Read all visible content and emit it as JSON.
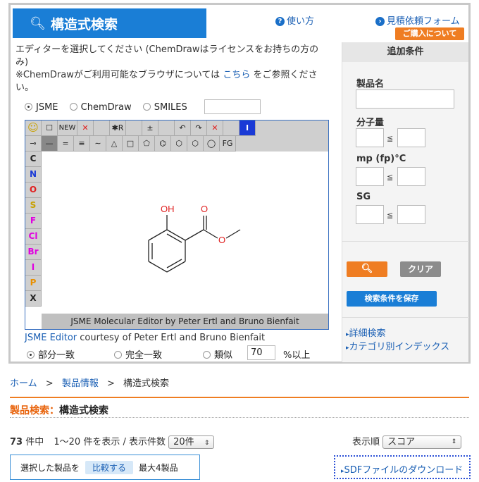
{
  "header": {
    "title": "構造式検索",
    "help_link": "使い方",
    "quote_link": "見積依頼フォーム",
    "purchase_button": "ご購入について"
  },
  "intro": {
    "line1": "エディターを選択してください (ChemDrawはライセンスをお持ちの方のみ)",
    "line2_pre": "※ChemDrawがご利用可能なブラウザについては ",
    "line2_link": "こちら",
    "line2_post": " をご参照ください。"
  },
  "editor_options": [
    "JSME",
    "ChemDraw",
    "SMILES"
  ],
  "editor_selected": "JSME",
  "smiles_value": "",
  "jsme": {
    "toolbar_row1": [
      "☺",
      "☐",
      "NEW",
      "✕",
      "",
      "✱R",
      "",
      "±",
      "",
      "↶",
      "↷",
      "✕",
      "",
      "I"
    ],
    "toolbar_row2": [
      "⊸",
      "—",
      "=",
      "≡",
      "∼",
      "△",
      "□",
      "⬠",
      "⌬",
      "⬡",
      "⬡",
      "◯",
      "FG"
    ],
    "atoms": [
      "C",
      "N",
      "O",
      "S",
      "F",
      "Cl",
      "Br",
      "I",
      "P",
      "X"
    ],
    "atom_colors": [
      "#222222",
      "#1a3ad6",
      "#e02020",
      "#c8a000",
      "#e000e0",
      "#e000e0",
      "#e000e0",
      "#e000e0",
      "#e89000",
      "#222222"
    ],
    "footer": "JSME Molecular Editor by Peter Ertl and Bruno Bienfait",
    "molecule_labels": {
      "oh": "OH",
      "o_carbonyl": "O",
      "o_ester": "O"
    }
  },
  "courtesy": {
    "link": "JSME Editor",
    "text": " courtesy of Peter Ertl and Bruno Bienfait"
  },
  "match": {
    "options": [
      "部分一致",
      "完全一致",
      "類似"
    ],
    "selected": "部分一致",
    "similarity_value": "70",
    "similarity_unit": "%以上"
  },
  "conditions": {
    "heading": "追加条件",
    "product_name_label": "製品名",
    "mw_label": "分子量",
    "mp_label": "mp (fp)°C",
    "sg_label": "SG",
    "le_symbol": "≦",
    "clear_button": "クリア",
    "save_button": "検索条件を保存",
    "detail_link": "詳細検索",
    "category_link": "カテゴリ別インデックス"
  },
  "breadcrumb": {
    "home": "ホーム",
    "sep": ">",
    "products": "製品情報",
    "current": "構造式検索"
  },
  "results": {
    "heading_prefix": "製品検索：",
    "heading_title": "構造式検索",
    "count": "73",
    "count_suffix": "件中",
    "range_text": "1〜20 件を表示 / 表示件数",
    "per_page": "20件",
    "sort_label": "表示順",
    "sort_value": "スコア",
    "compare_prefix": "選択した製品を",
    "compare_button": "比較する",
    "compare_limit": "最大4製品",
    "sdf_link": "SDFファイルのダウンロード"
  },
  "colors": {
    "brand_blue": "#1a7ed6",
    "accent_orange": "#ef7d22",
    "link_blue": "#1a5fb4"
  }
}
